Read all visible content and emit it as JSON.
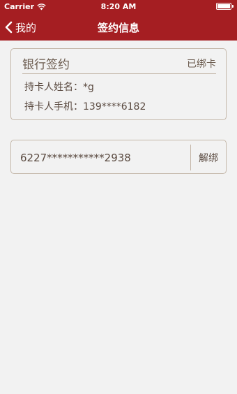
{
  "status_bar": {
    "carrier": "Carrier",
    "time": "8:20 AM"
  },
  "nav": {
    "back_label": "我的",
    "title": "签约信息"
  },
  "bank_card": {
    "title": "银行签约",
    "status": "已绑卡",
    "holder_name_label": "持卡人姓名：",
    "holder_name_value": "*g",
    "holder_phone_label": "持卡人手机：",
    "holder_phone_value": "139****6182"
  },
  "account": {
    "number": "6227***********2938",
    "unbind_label": "解绑"
  },
  "colors": {
    "brand_red": "#a51e22",
    "border": "#c4b7a9",
    "background": "#f2f2f2"
  }
}
